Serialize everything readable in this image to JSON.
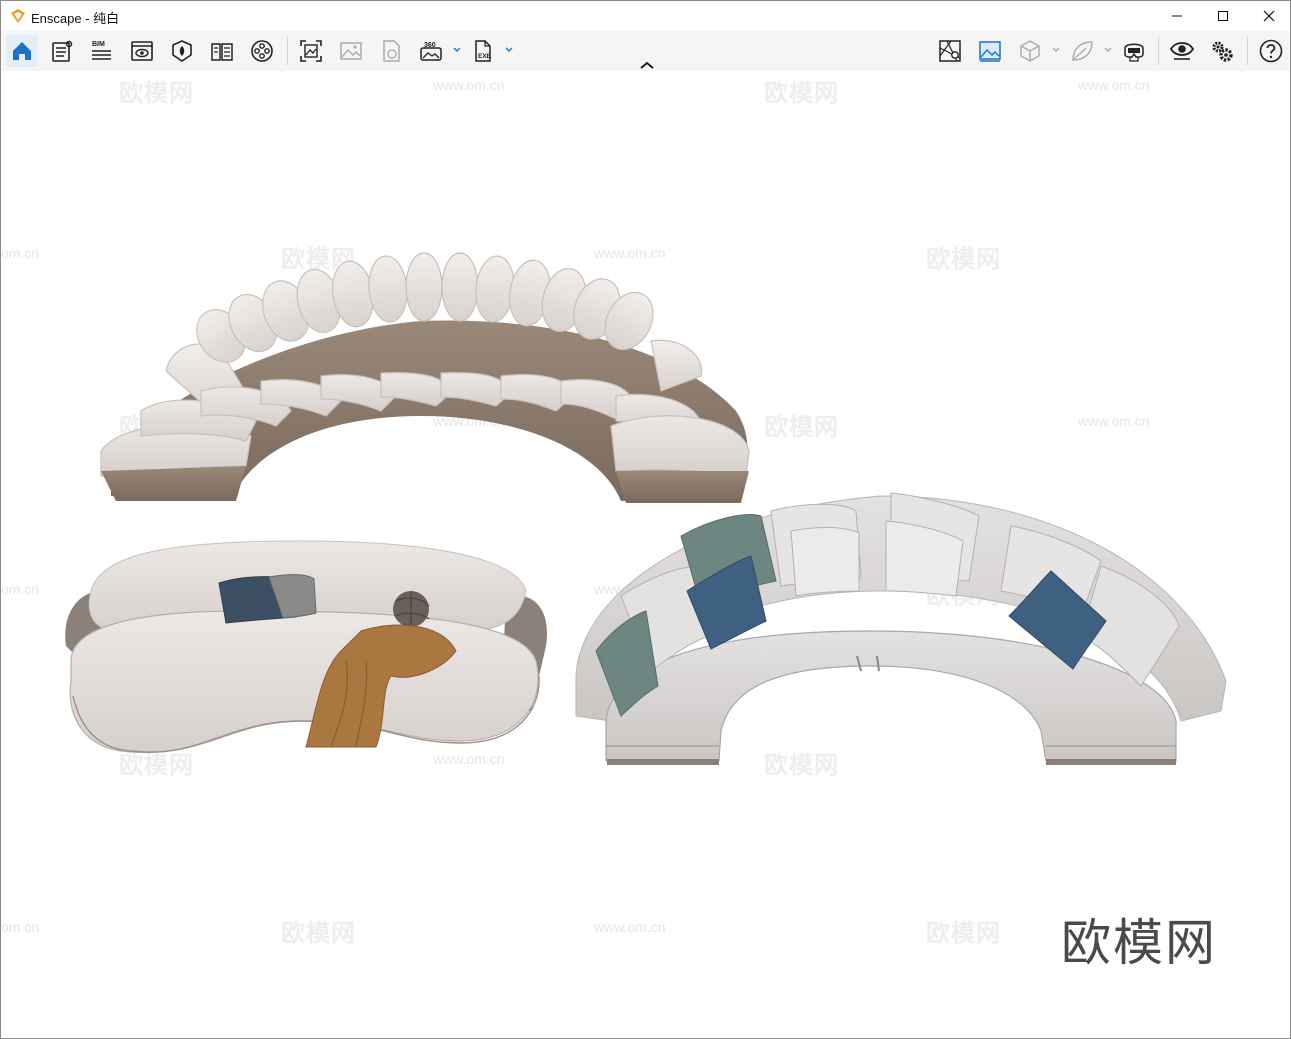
{
  "window": {
    "title": "Enscape - 纯白",
    "controls": [
      "minimize-icon",
      "maximize-icon",
      "close-icon"
    ]
  },
  "toolbar": {
    "left_icons": [
      "home-icon",
      "document-list-icon",
      "bim-icon",
      "visual-settings-icon",
      "asset-library-icon",
      "manual-book-icon",
      "video-editor-icon"
    ],
    "bim_label": "BIM",
    "capture_icons": [
      "screenshot-icon",
      "batch-render-icon",
      "panorama-upload-icon",
      "panorama-360-icon",
      "export-exe-icon"
    ],
    "pano_label": "360",
    "exe_label": "EXE",
    "right_icons": [
      "site-context-icon",
      "views-icon",
      "object-cube-icon",
      "leaf-icon",
      "vr-headset-icon",
      "eye-preview-icon",
      "settings-gears-icon",
      "help-icon"
    ]
  },
  "viewport": {
    "watermark_brand": "欧模网",
    "watermark_url": "www.om.cn",
    "corner_brand": "欧模网",
    "partial_url": "om.cn"
  },
  "colors": {
    "accent": "#1a73c9",
    "toolbar_bg": "#f5f5f5",
    "sofa_fabric": "#e8e2df",
    "sofa_base": "#8b7a6c",
    "pillow_blue": "#3e6182",
    "pillow_green": "#6e8682",
    "throw_brown": "#a9773f"
  }
}
